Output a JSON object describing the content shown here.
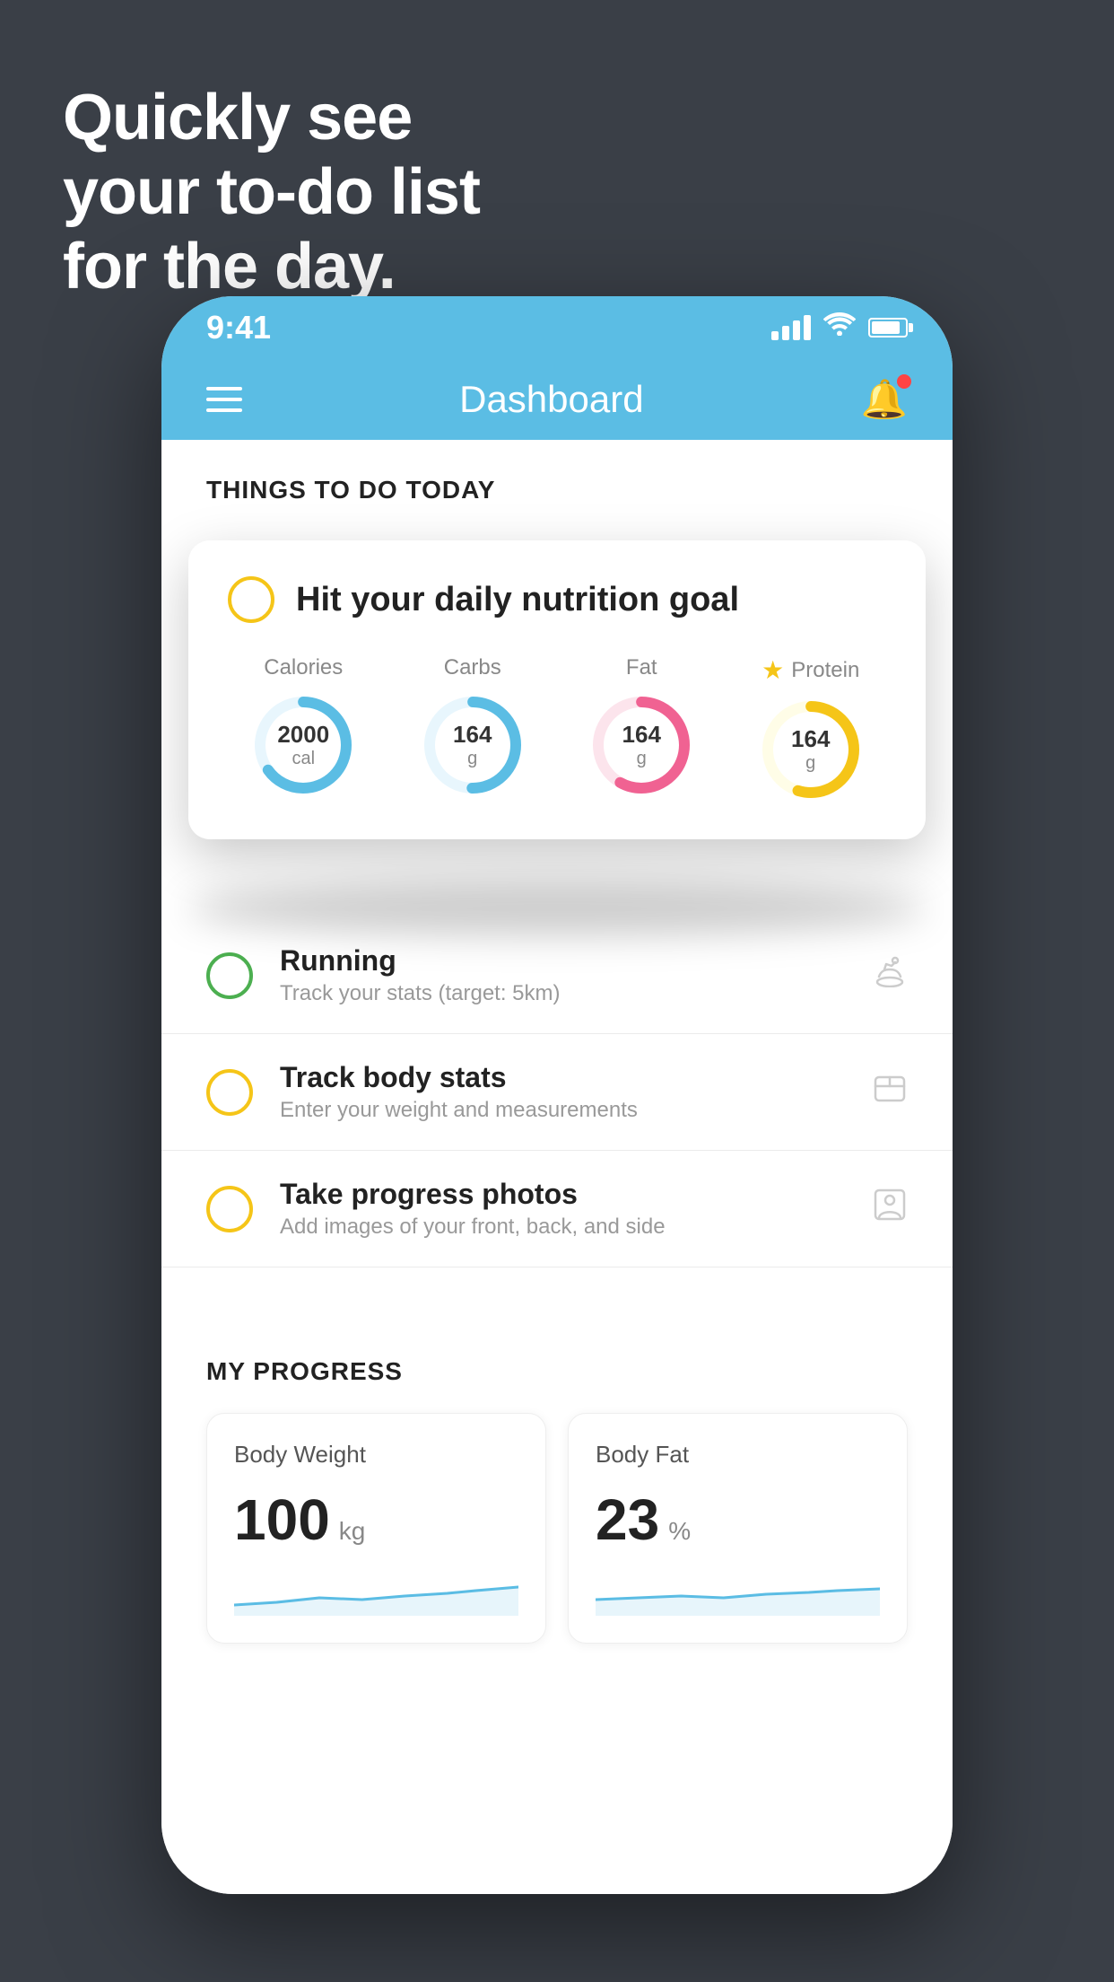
{
  "background": {
    "color": "#3a3f47"
  },
  "headline": {
    "line1": "Quickly see",
    "line2": "your to-do list",
    "line3": "for the day."
  },
  "phone": {
    "status_bar": {
      "time": "9:41",
      "signal_bars": 4,
      "has_wifi": true,
      "has_battery": true
    },
    "nav": {
      "title": "Dashboard",
      "has_menu": true,
      "has_bell": true,
      "bell_has_dot": true
    },
    "things_to_do": {
      "section_title": "THINGS TO DO TODAY",
      "featured_item": {
        "label": "Hit your daily nutrition goal",
        "circle_color": "yellow",
        "nutrients": [
          {
            "name": "Calories",
            "value": "2000",
            "unit": "cal",
            "color": "#5bbde4",
            "track_color": "#e8f6fd",
            "progress": 65,
            "is_star": false
          },
          {
            "name": "Carbs",
            "value": "164",
            "unit": "g",
            "color": "#5bbde4",
            "track_color": "#e8f6fd",
            "progress": 50,
            "is_star": false
          },
          {
            "name": "Fat",
            "value": "164",
            "unit": "g",
            "color": "#f06292",
            "track_color": "#fce4ec",
            "progress": 70,
            "is_star": false
          },
          {
            "name": "Protein",
            "value": "164",
            "unit": "g",
            "color": "#f5c518",
            "track_color": "#fffde7",
            "progress": 55,
            "is_star": true
          }
        ]
      },
      "items": [
        {
          "id": "running",
          "name": "Running",
          "sub": "Track your stats (target: 5km)",
          "circle_color": "green",
          "icon": "🥿"
        },
        {
          "id": "body-stats",
          "name": "Track body stats",
          "sub": "Enter your weight and measurements",
          "circle_color": "yellow",
          "icon": "⚖"
        },
        {
          "id": "photos",
          "name": "Take progress photos",
          "sub": "Add images of your front, back, and side",
          "circle_color": "yellow",
          "icon": "👤"
        }
      ]
    },
    "my_progress": {
      "section_title": "MY PROGRESS",
      "cards": [
        {
          "title": "Body Weight",
          "value": "100",
          "unit": "kg",
          "chart_color": "#5bbde4"
        },
        {
          "title": "Body Fat",
          "value": "23",
          "unit": "%",
          "chart_color": "#5bbde4"
        }
      ]
    }
  }
}
